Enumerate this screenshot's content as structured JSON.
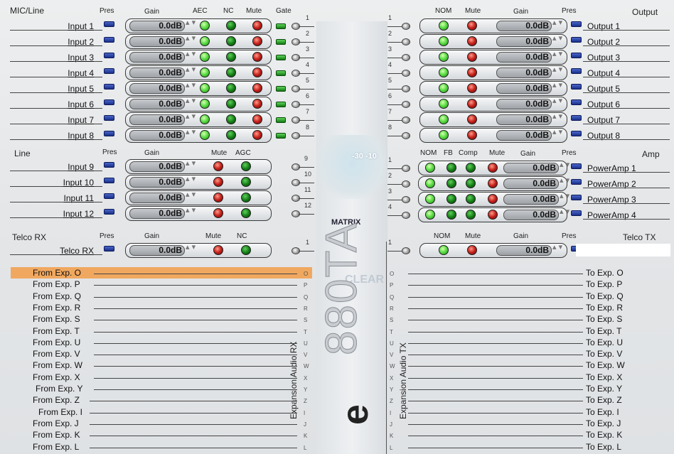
{
  "sections": {
    "mic_line": "MIC/Line",
    "line": "Line",
    "telco_rx": "Telco RX",
    "output": "Output",
    "amp": "Amp",
    "telco_tx": "Telco TX",
    "matrix": "MATRIX",
    "exp_rx": "Expansion Audio RX",
    "exp_tx": "Expansion Audio TX"
  },
  "headers": {
    "pres": "Pres",
    "gain": "Gain",
    "aec": "AEC",
    "nc": "NC",
    "mute": "Mute",
    "gate": "Gate",
    "agc": "AGC",
    "nom": "NOM",
    "fb": "FB",
    "comp": "Comp"
  },
  "gain_value": "0.0dB",
  "inputs": [
    {
      "label": "Input 1",
      "num": "1"
    },
    {
      "label": "Input 2",
      "num": "2"
    },
    {
      "label": "Input 3",
      "num": "3"
    },
    {
      "label": "Input 4",
      "num": "4"
    },
    {
      "label": "Input 5",
      "num": "5"
    },
    {
      "label": "Input 6",
      "num": "6"
    },
    {
      "label": "Input 7",
      "num": "7"
    },
    {
      "label": "Input 8",
      "num": "8"
    }
  ],
  "line_inputs": [
    {
      "label": "Input 9",
      "num": "9"
    },
    {
      "label": "Input 10",
      "num": "10"
    },
    {
      "label": "Input 11",
      "num": "11"
    },
    {
      "label": "Input 12",
      "num": "12"
    }
  ],
  "telco_rx": {
    "label": "Telco RX",
    "num": "1"
  },
  "outputs": [
    {
      "label": "Output 1",
      "num": "1"
    },
    {
      "label": "Output 2",
      "num": "2"
    },
    {
      "label": "Output 3",
      "num": "3"
    },
    {
      "label": "Output 4",
      "num": "4"
    },
    {
      "label": "Output 5",
      "num": "5"
    },
    {
      "label": "Output 6",
      "num": "6"
    },
    {
      "label": "Output 7",
      "num": "7"
    },
    {
      "label": "Output 8",
      "num": "8"
    }
  ],
  "amps": [
    {
      "label": "PowerAmp 1",
      "num": "1"
    },
    {
      "label": "PowerAmp 2",
      "num": "2"
    },
    {
      "label": "PowerAmp 3",
      "num": "3"
    },
    {
      "label": "PowerAmp 4",
      "num": "4"
    }
  ],
  "telco_tx": {
    "label": "Telco TX",
    "num": "1"
  },
  "matrix_readout": "-30 -10",
  "from_exp": [
    "From Exp. O",
    "From Exp. P",
    "From Exp. Q",
    "From Exp. R",
    "From Exp. S",
    "From Exp. T",
    "From Exp. U",
    "From Exp. V",
    "From Exp. W",
    "From Exp. X",
    "From Exp. Y",
    "From Exp. Z",
    "From Exp. I",
    "From Exp. J",
    "From Exp. K",
    "From Exp. L"
  ],
  "to_exp": [
    "To Exp. O",
    "To Exp. P",
    "To Exp. Q",
    "To Exp. R",
    "To Exp. S",
    "To Exp. T",
    "To Exp. U",
    "To Exp. V",
    "To Exp. W",
    "To Exp. X",
    "To Exp. Y",
    "To Exp. Z",
    "To Exp. I",
    "To Exp. J",
    "To Exp. K",
    "To Exp. L"
  ],
  "exp_letters": [
    "O",
    "P",
    "Q",
    "R",
    "S",
    "T",
    "U",
    "V",
    "W",
    "X",
    "Y",
    "Z",
    "I",
    "J",
    "K",
    "L"
  ],
  "brand": {
    "model": "880TA",
    "suffix": "e",
    "watermark": "CLEAR"
  },
  "colors": {
    "highlight": "#f0a860",
    "led_green": "#5fe04a",
    "led_red": "#c4201a",
    "pres_blue": "#1a2f8a"
  }
}
